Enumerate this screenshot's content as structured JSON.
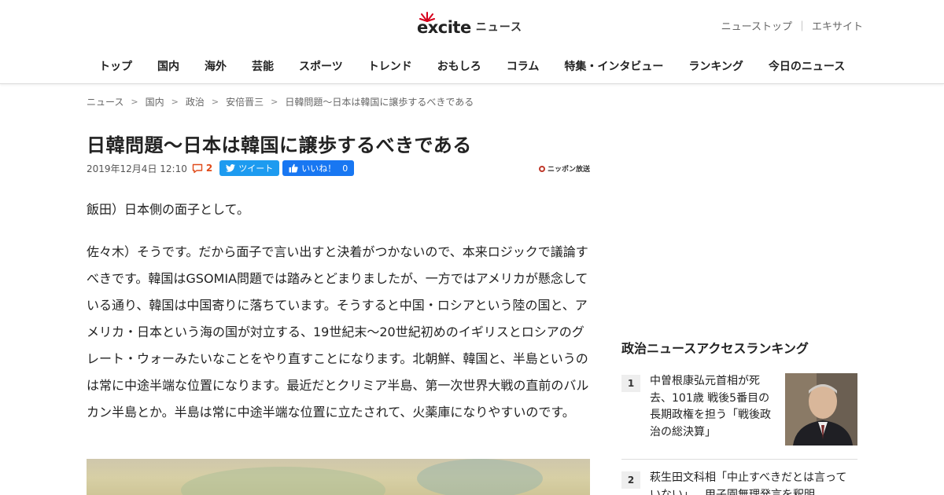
{
  "header": {
    "logo_text": "excite",
    "logo_sub": "ニュース",
    "toplinks": [
      "ニューストップ",
      "エキサイト"
    ],
    "toplink_separator": "｜",
    "nav": [
      "トップ",
      "国内",
      "海外",
      "芸能",
      "スポーツ",
      "トレンド",
      "おもしろ",
      "コラム",
      "特集・インタビュー",
      "ランキング",
      "今日のニュース"
    ]
  },
  "breadcrumb": {
    "separator": ">",
    "items": [
      "ニュース",
      "国内",
      "政治",
      "安倍晋三",
      "日韓問題～日本は韓国に譲歩するべきである"
    ]
  },
  "article": {
    "title": "日韓問題～日本は韓国に譲歩するべきである",
    "date": "2019年12月4日 12:10",
    "comment_count": "2",
    "tweet_label": "ツイート",
    "like_label": "いいね！",
    "like_count": "0",
    "source_name": "ニッポン放送",
    "paragraphs": [
      "飯田）日本側の面子として。",
      "佐々木）そうです。だから面子で言い出すと決着がつかないので、本来ロジックで議論すべきです。韓国はGSOMIA問題では踏みとどまりましたが、一方ではアメリカが懸念している通り、韓国は中国寄りに落ちています。そうすると中国・ロシアという陸の国と、アメリカ・日本という海の国が対立する、19世紀末～20世紀初めのイギリスとロシアのグレート・ウォーみたいなことをやり直すことになります。北朝鮮、韓国と、半島というのは常に中途半端な位置になります。最近だとクリミア半島、第一次世界大戦の直前のバルカン半島とか。半島は常に中途半端な位置に立たされて、火薬庫になりやすいのです。"
    ]
  },
  "sidebar": {
    "ranking_title": "政治ニュースアクセスランキング",
    "items": [
      {
        "rank": "1",
        "text": "中曽根康弘元首相が死去、101歳 戦後5番目の長期政権を担う「戦後政治の総決算」"
      },
      {
        "rank": "2",
        "text": "萩生田文科相「中止すべきだとは言っていない」…甲子園無理発言を釈明"
      }
    ]
  },
  "colors": {
    "twitter": "#1d9bf0",
    "facebook": "#1877f2",
    "comment_accent": "#e04b1a",
    "logo_burst": "#d6001c"
  }
}
